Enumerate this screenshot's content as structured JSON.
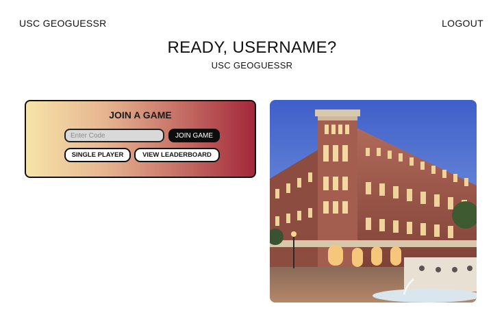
{
  "header": {
    "brand": "USC GEOGUESSR",
    "logout_label": "LOGOUT"
  },
  "hero": {
    "title": "READY, USERNAME?",
    "subtitle": "USC GEOGUESSR"
  },
  "join_card": {
    "title": "JOIN A GAME",
    "code_placeholder": "Enter Code",
    "code_value": "",
    "join_label": "JOIN GAME",
    "single_player_label": "SINGLE PLAYER",
    "leaderboard_label": "VIEW LEADERBOARD"
  },
  "photo": {
    "subject": "usc-campus-building-photo"
  }
}
